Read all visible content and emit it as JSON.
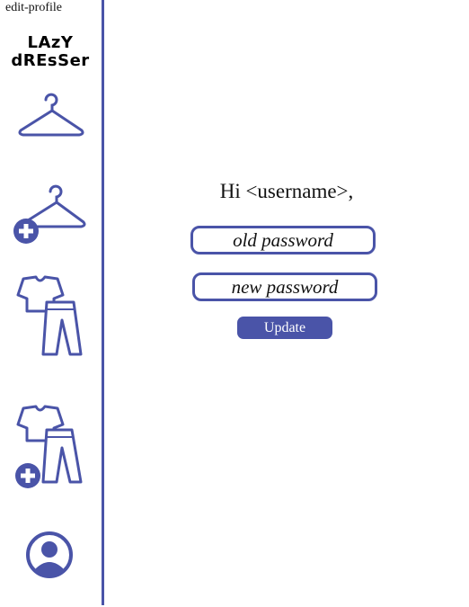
{
  "page": {
    "label": "edit-profile"
  },
  "sidebar": {
    "logo_line1": "LAzY",
    "logo_line2": "dREsSer",
    "accent_color": "#4a54a8",
    "items": [
      {
        "icon": "hanger-icon"
      },
      {
        "icon": "add-hanger-icon"
      },
      {
        "icon": "outfit-icon"
      },
      {
        "icon": "add-outfit-icon"
      },
      {
        "icon": "profile-icon"
      }
    ]
  },
  "main": {
    "greeting": "Hi <username>,",
    "old_password_placeholder": "old password",
    "new_password_placeholder": "new password",
    "update_label": "Update"
  }
}
